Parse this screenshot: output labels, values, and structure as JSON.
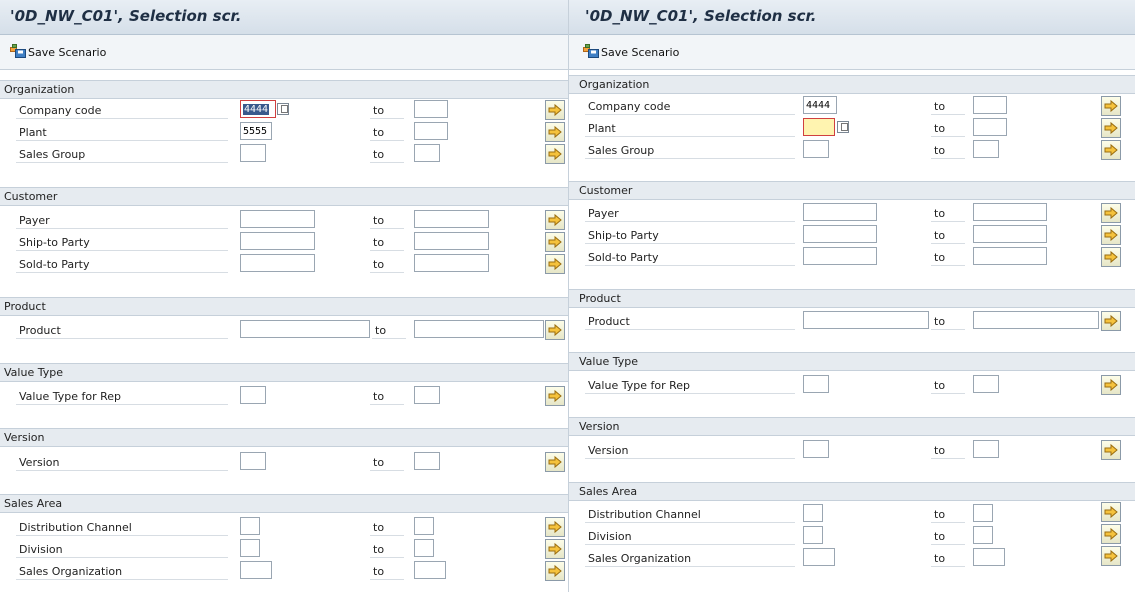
{
  "left": {
    "title": "'0D_NW_C01', Selection scr.",
    "save_label": "Save Scenario",
    "groups": [
      {
        "name": "Organization"
      },
      {
        "name": "Customer"
      },
      {
        "name": "Product"
      },
      {
        "name": "Value Type"
      },
      {
        "name": "Version"
      },
      {
        "name": "Sales Area"
      }
    ],
    "fields": [
      {
        "label": "Company code",
        "from_value": "4444",
        "to_label": "to"
      },
      {
        "label": "Plant",
        "from_value": "5555",
        "to_label": "to"
      },
      {
        "label": "Sales Group",
        "from_value": "",
        "to_label": "to"
      },
      {
        "label": "Payer",
        "from_value": "",
        "to_label": "to"
      },
      {
        "label": "Ship-to Party",
        "from_value": "",
        "to_label": "to"
      },
      {
        "label": "Sold-to Party",
        "from_value": "",
        "to_label": "to"
      },
      {
        "label": "Product",
        "from_value": "",
        "to_label": "to"
      },
      {
        "label": "Value Type for Rep",
        "from_value": "",
        "to_label": "to"
      },
      {
        "label": "Version",
        "from_value": "",
        "to_label": "to"
      },
      {
        "label": "Distribution Channel",
        "from_value": "",
        "to_label": "to"
      },
      {
        "label": "Division",
        "from_value": "",
        "to_label": "to"
      },
      {
        "label": "Sales Organization",
        "from_value": "",
        "to_label": "to"
      }
    ]
  },
  "right": {
    "title": "'0D_NW_C01', Selection scr.",
    "save_label": "Save Scenario",
    "groups": [
      {
        "name": "Organization"
      },
      {
        "name": "Customer"
      },
      {
        "name": "Product"
      },
      {
        "name": "Value Type"
      },
      {
        "name": "Version"
      },
      {
        "name": "Sales Area"
      }
    ],
    "fields": [
      {
        "label": "Company code",
        "from_value": "4444",
        "to_label": "to"
      },
      {
        "label": "Plant",
        "from_value": "",
        "to_label": "to"
      },
      {
        "label": "Sales Group",
        "from_value": "",
        "to_label": "to"
      },
      {
        "label": "Payer",
        "from_value": "",
        "to_label": "to"
      },
      {
        "label": "Ship-to Party",
        "from_value": "",
        "to_label": "to"
      },
      {
        "label": "Sold-to Party",
        "from_value": "",
        "to_label": "to"
      },
      {
        "label": "Product",
        "from_value": "",
        "to_label": "to"
      },
      {
        "label": "Value Type for Rep",
        "from_value": "",
        "to_label": "to"
      },
      {
        "label": "Version",
        "from_value": "",
        "to_label": "to"
      },
      {
        "label": "Distribution Channel",
        "from_value": "",
        "to_label": "to"
      },
      {
        "label": "Division",
        "from_value": "",
        "to_label": "to"
      },
      {
        "label": "Sales Organization",
        "from_value": "",
        "to_label": "to"
      }
    ]
  },
  "icons": {
    "save": "save-scenario-icon",
    "multiple_selection": "multiple-selection-arrow-icon",
    "value_help": "value-help-icon"
  },
  "colors": {
    "title_bar": "#d5dfe9",
    "group_header": "#e6ebf0",
    "focus_border": "#d04040",
    "selected_text_bg": "#39598c",
    "focused_field_bg": "#fff4b0",
    "button_bg": "#e6e6c7"
  }
}
